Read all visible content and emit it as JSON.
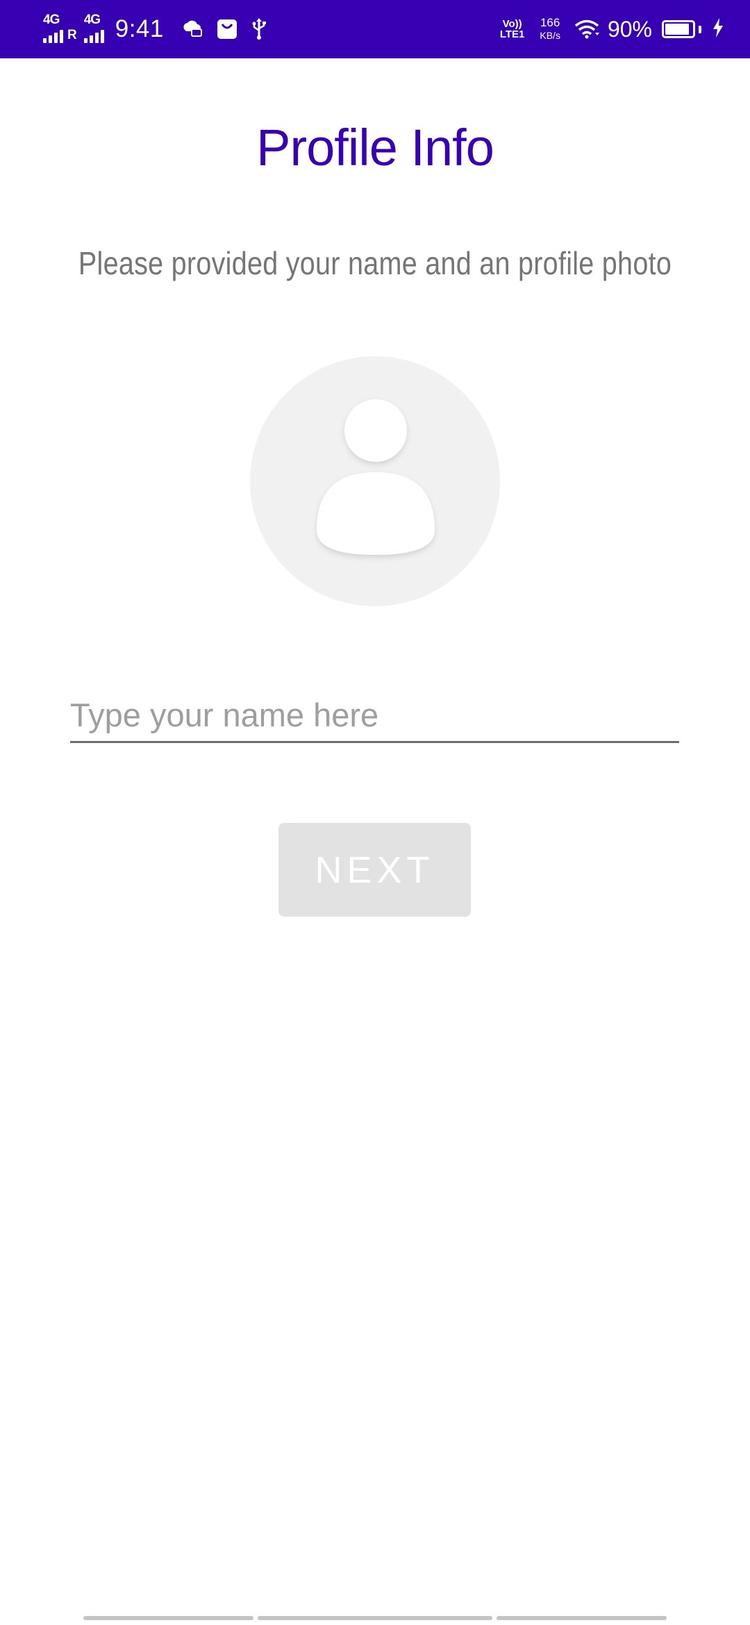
{
  "status_bar": {
    "network_1": "4G",
    "roaming": "R",
    "network_2": "4G",
    "time": "9:41",
    "volte_top": "Vo))",
    "volte_bottom": "LTE1",
    "speed_value": "166",
    "speed_unit": "KB/s",
    "battery_percent": "90%",
    "battery_level": 0.9,
    "icons": [
      "signal-icon",
      "signal-icon",
      "cloud-chat-icon",
      "shopping-bag-icon",
      "usb-icon",
      "wifi-icon",
      "battery-icon",
      "charging-bolt-icon"
    ],
    "background_color": "#3700b3"
  },
  "main": {
    "title": "Profile Info",
    "subtitle": "Please provided your name and an profile photo",
    "avatar_icon": "person-placeholder-icon",
    "name_input": {
      "value": "",
      "placeholder": "Type your name here"
    },
    "next_button": {
      "label": "NEXT",
      "enabled": false
    }
  },
  "colors": {
    "accent": "#3700b3",
    "subtitle_text": "#757575",
    "disabled_button": "#e2e2e2",
    "avatar_bg": "#f1f1f2"
  }
}
